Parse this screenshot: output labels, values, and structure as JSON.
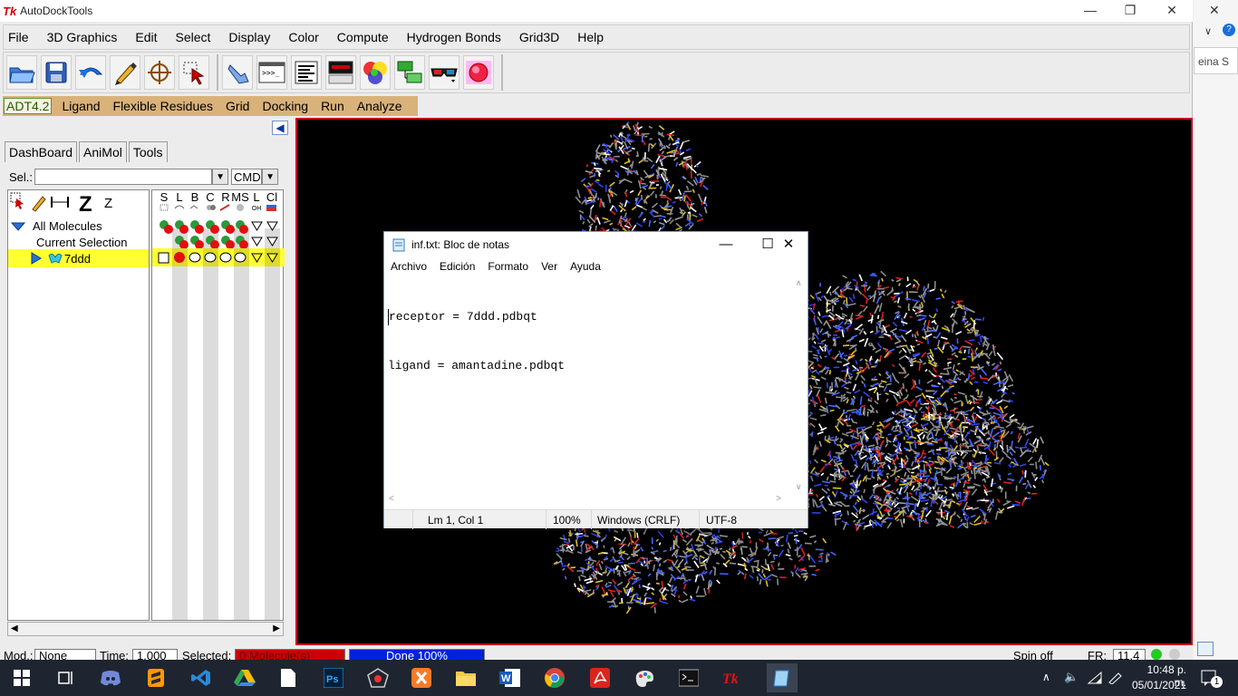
{
  "window": {
    "title": "AutoDockTools",
    "logo": "Tk"
  },
  "menubar": [
    "File",
    "3D Graphics",
    "Edit",
    "Select",
    "Display",
    "Color",
    "Compute",
    "Hydrogen Bonds",
    "Grid3D",
    "Help"
  ],
  "adt_menu": {
    "version": "ADT4.2",
    "items": [
      "Ligand",
      "Flexible Residues",
      "Grid",
      "Docking",
      "Run",
      "Analyze"
    ]
  },
  "dashboard": {
    "tabs": [
      "DashBoard",
      "AniMol",
      "Tools"
    ],
    "sel_label": "Sel.:",
    "sel_value": "",
    "cmd_label": "CMD",
    "header_icons": [
      "select-icon",
      "pencil-icon",
      "distance-icon",
      "Z"
    ],
    "header_small": "Z",
    "col_headers": [
      "S",
      "L",
      "B",
      "C",
      "R",
      "MS",
      "L",
      "Cl"
    ],
    "col_subheaders": [
      "",
      "",
      "",
      "",
      "",
      "",
      "OH",
      ""
    ],
    "tree": [
      {
        "label": "All Molecules",
        "level": 0
      },
      {
        "label": "Current Selection",
        "level": 1
      },
      {
        "label": "7ddd",
        "level": 1,
        "selected": true
      }
    ]
  },
  "statusbar": {
    "mod_label": "Mod.:",
    "mod_value": "None",
    "time_label": "Time:",
    "time_value": "1.000",
    "selected_label": "Selected:",
    "selected_value": "0 Molecule(s)",
    "progress_text": "Done 100%",
    "spin": "Spin off",
    "fr_label": "FR:",
    "fr_value": "11.4"
  },
  "notepad": {
    "title": "inf.txt: Bloc de notas",
    "menu": [
      "Archivo",
      "Edición",
      "Formato",
      "Ver",
      "Ayuda"
    ],
    "lines": [
      "receptor = 7ddd.pdbqt",
      "ligand = amantadine.pdbqt"
    ],
    "status": {
      "position": "Lm 1, Col 1",
      "zoom": "100%",
      "eol": "Windows (CRLF)",
      "encoding": "UTF-8"
    }
  },
  "right_strip": {
    "text": "eina S"
  },
  "taskbar": {
    "time": "10:48 p. m.",
    "date": "05/01/2021",
    "notifications": "1"
  },
  "colors": {
    "accent_red": "#c8001c",
    "adt_bar": "#d9b27a",
    "selection_yellow": "#ffff33",
    "progress_blue": "#0022dd",
    "selected_red": "#cc0000"
  }
}
